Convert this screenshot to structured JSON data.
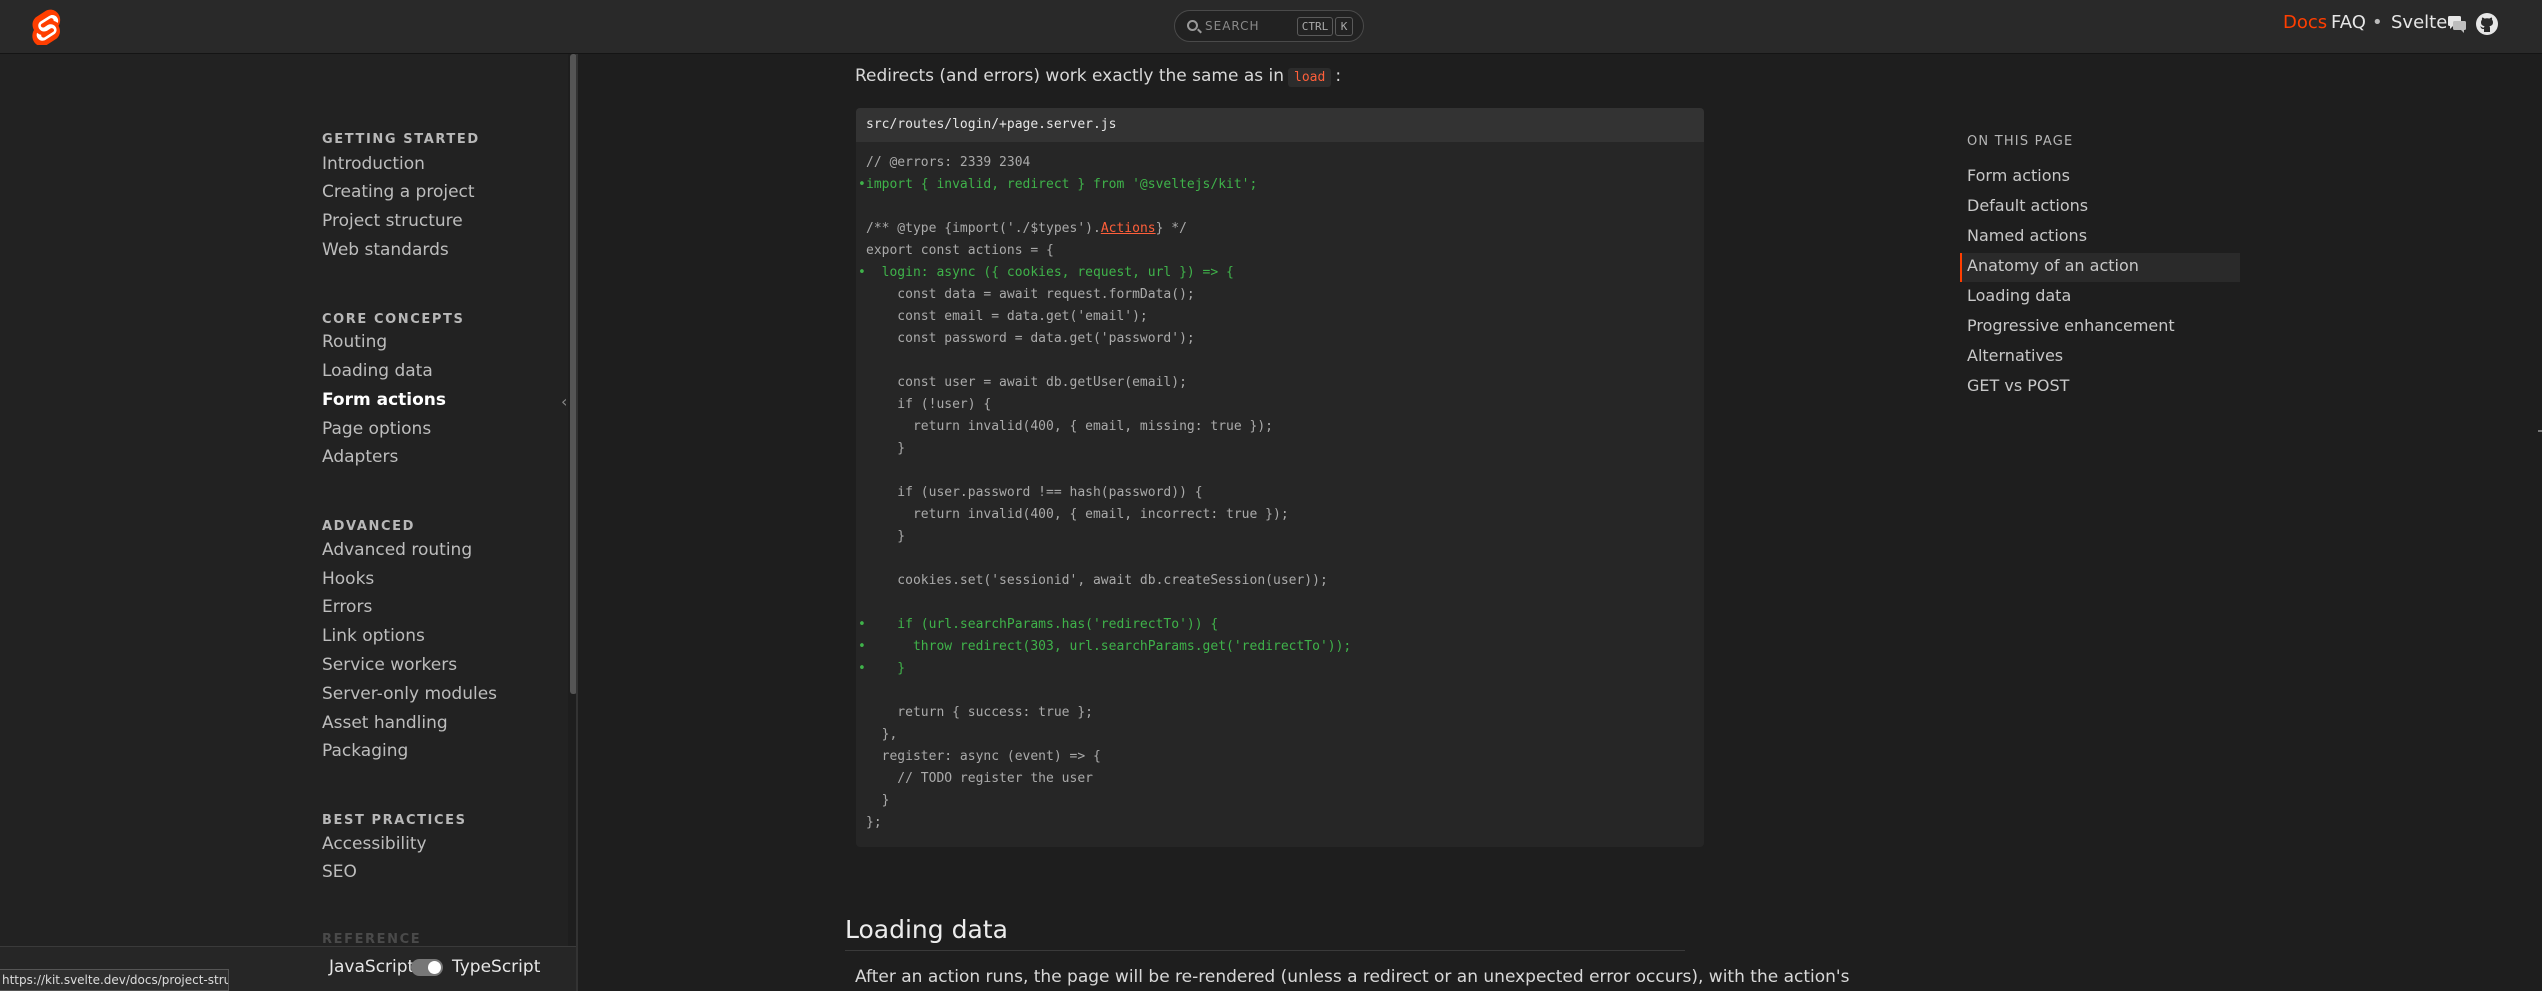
{
  "header": {
    "search_placeholder": "SEARCH",
    "kbd_ctrl": "CTRL",
    "kbd_k": "K",
    "nav_docs": "Docs",
    "nav_faq": "FAQ",
    "nav_dot": "•",
    "nav_svelte": "Svelte",
    "accent_color": "#ff3e00"
  },
  "sidebar": {
    "sections": [
      {
        "title": "GETTING STARTED",
        "items": [
          "Introduction",
          "Creating a project",
          "Project structure",
          "Web standards"
        ]
      },
      {
        "title": "CORE CONCEPTS",
        "items": [
          "Routing",
          "Loading data",
          "Form actions",
          "Page options",
          "Adapters"
        ]
      },
      {
        "title": "ADVANCED",
        "items": [
          "Advanced routing",
          "Hooks",
          "Errors",
          "Link options",
          "Service workers",
          "Server-only modules",
          "Asset handling",
          "Packaging"
        ]
      },
      {
        "title": "BEST PRACTICES",
        "items": [
          "Accessibility",
          "SEO"
        ]
      }
    ],
    "active_item": "Form actions",
    "faded_section": "REFERENCE",
    "lang_js": "JavaScript",
    "lang_ts": "TypeScript",
    "status_url": "https://kit.svelte.dev/docs/project-structure"
  },
  "content": {
    "intro_before": "Redirects (and errors) work exactly the same as in",
    "intro_code": "load",
    "intro_after": ":",
    "code_filename": "src/routes/login/+page.server.js",
    "code_lines": [
      {
        "text": "// @errors: 2339 2304",
        "added": false
      },
      {
        "text": "import { invalid, redirect } from '@sveltejs/kit';",
        "added": true
      },
      {
        "text": "",
        "added": false
      },
      {
        "text": "/** @type {import('./$types').Actions} */",
        "added": false,
        "highlight": "Actions"
      },
      {
        "text": "export const actions = {",
        "added": false
      },
      {
        "text": "  login: async ({ cookies, request, url }) => {",
        "added": true
      },
      {
        "text": "    const data = await request.formData();",
        "added": false
      },
      {
        "text": "    const email = data.get('email');",
        "added": false
      },
      {
        "text": "    const password = data.get('password');",
        "added": false
      },
      {
        "text": "",
        "added": false
      },
      {
        "text": "    const user = await db.getUser(email);",
        "added": false
      },
      {
        "text": "    if (!user) {",
        "added": false
      },
      {
        "text": "      return invalid(400, { email, missing: true });",
        "added": false
      },
      {
        "text": "    }",
        "added": false
      },
      {
        "text": "",
        "added": false
      },
      {
        "text": "    if (user.password !== hash(password)) {",
        "added": false
      },
      {
        "text": "      return invalid(400, { email, incorrect: true });",
        "added": false
      },
      {
        "text": "    }",
        "added": false
      },
      {
        "text": "",
        "added": false
      },
      {
        "text": "    cookies.set('sessionid', await db.createSession(user));",
        "added": false
      },
      {
        "text": "",
        "added": false
      },
      {
        "text": "    if (url.searchParams.has('redirectTo')) {",
        "added": true
      },
      {
        "text": "      throw redirect(303, url.searchParams.get('redirectTo'));",
        "added": true
      },
      {
        "text": "    }",
        "added": true
      },
      {
        "text": "",
        "added": false
      },
      {
        "text": "    return { success: true };",
        "added": false
      },
      {
        "text": "  },",
        "added": false
      },
      {
        "text": "  register: async (event) => {",
        "added": false
      },
      {
        "text": "    // TODO register the user",
        "added": false
      },
      {
        "text": "  }",
        "added": false
      },
      {
        "text": "};",
        "added": false
      }
    ],
    "heading": "Loading data",
    "paragraph": "After an action runs, the page will be re-rendered (unless a redirect or an unexpected error occurs), with the action's"
  },
  "toc": {
    "title": "ON THIS PAGE",
    "items": [
      "Form actions",
      "Default actions",
      "Named actions",
      "Anatomy of an action",
      "Loading data",
      "Progressive enhancement",
      "Alternatives",
      "GET vs POST"
    ],
    "active_item": "Anatomy of an action"
  }
}
